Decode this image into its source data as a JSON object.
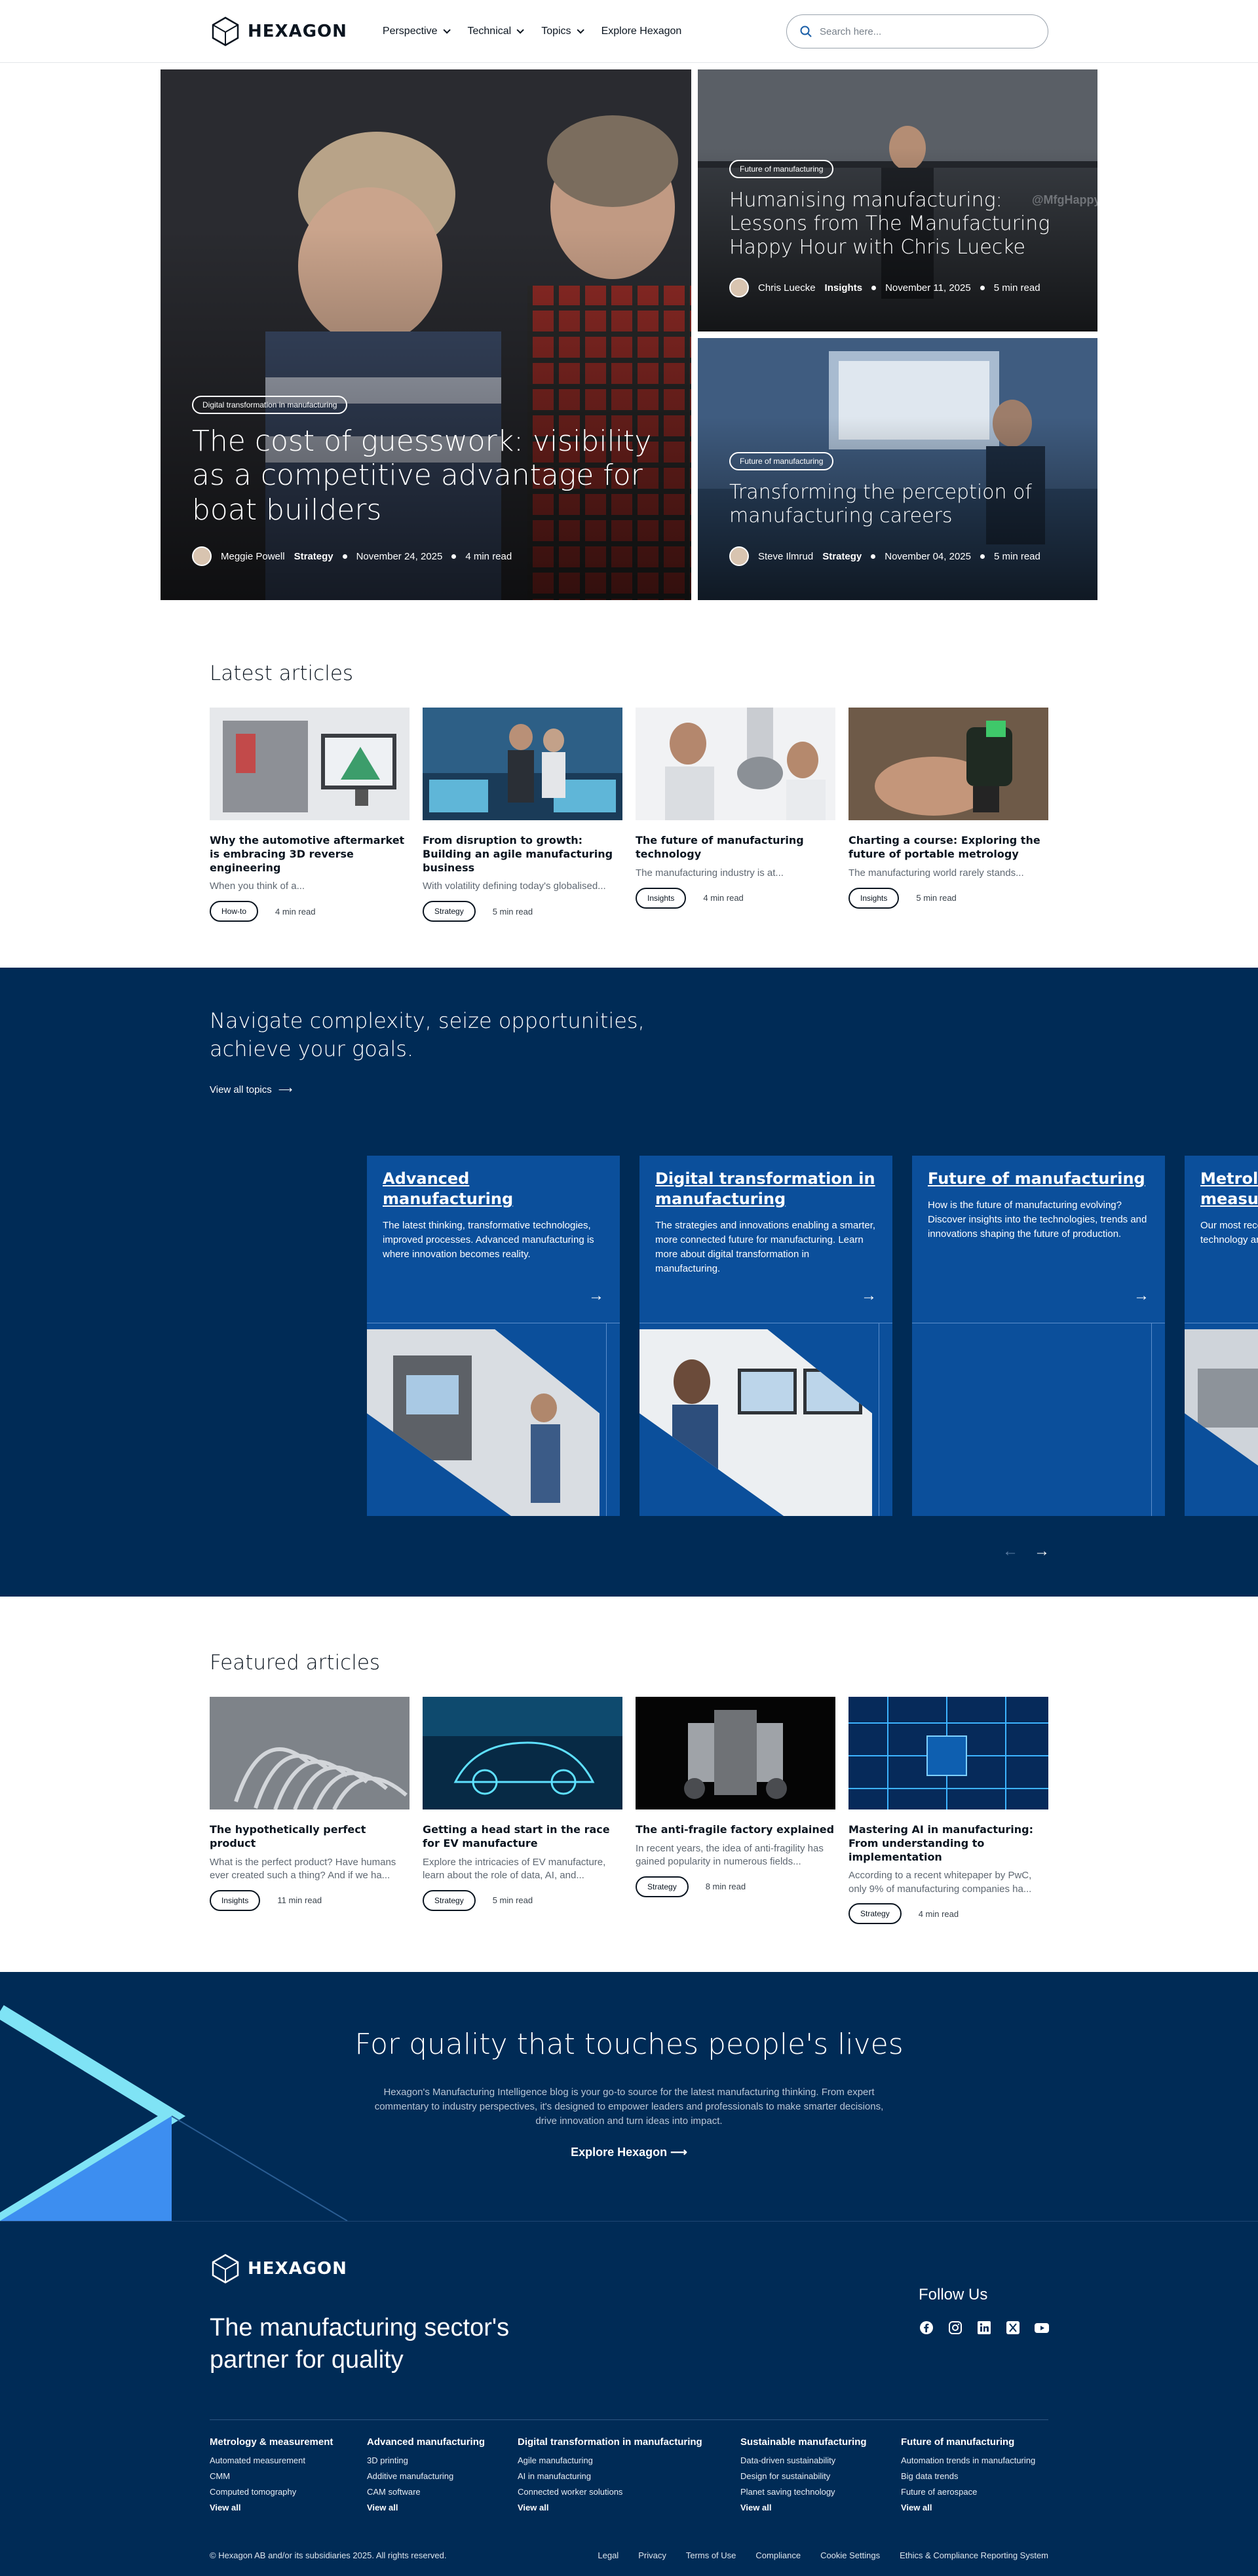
{
  "header": {
    "brand": "HEXAGON",
    "nav": [
      {
        "label": "Perspective",
        "has_menu": true
      },
      {
        "label": "Technical",
        "has_menu": true
      },
      {
        "label": "Topics",
        "has_menu": true
      },
      {
        "label": "Explore Hexagon",
        "has_menu": false
      }
    ],
    "search_placeholder": "Search here..."
  },
  "hero": {
    "main": {
      "tag": "Digital transformation in manufacturing",
      "title": "The cost of guesswork: visibility as a competitive advantage for boat builders",
      "author": "Meggie Powell",
      "category": "Strategy",
      "date": "November 24, 2025",
      "read": "4 min read"
    },
    "side": [
      {
        "tag": "Future of manufacturing",
        "title": "Humanising manufacturing: Lessons from The Manufacturing Happy Hour with Chris Luecke",
        "author": "Chris Luecke",
        "category": "Insights",
        "date": "November 11, 2025",
        "read": "5 min read"
      },
      {
        "tag": "Future of manufacturing",
        "title": "Transforming the perception of manufacturing careers",
        "author": "Steve Ilmrud",
        "category": "Strategy",
        "date": "November 04, 2025",
        "read": "5 min read"
      }
    ]
  },
  "latest": {
    "title": "Latest articles",
    "items": [
      {
        "title": "Why the automotive aftermarket is embracing 3D reverse engineering",
        "excerpt": "When you think of a...",
        "tag": "How-to",
        "read": "4 min read"
      },
      {
        "title": "From disruption to growth: Building an agile manufacturing business",
        "excerpt": "With volatility defining today's globalised...",
        "tag": "Strategy",
        "read": "5 min read"
      },
      {
        "title": "The future of manufacturing technology",
        "excerpt": "The manufacturing industry is at...",
        "tag": "Insights",
        "read": "4 min read"
      },
      {
        "title": "Charting a course: Exploring the future of portable metrology",
        "excerpt": "The manufacturing world rarely stands...",
        "tag": "Insights",
        "read": "5 min read"
      }
    ]
  },
  "topics": {
    "heading": "Navigate complexity, seize opportunities, achieve your goals.",
    "view_all": "View all topics",
    "cards": [
      {
        "title": "Advanced manufacturing",
        "text": "The latest thinking, transformative technologies, improved processes. Advanced manufacturing is where innovation becomes reality."
      },
      {
        "title": "Digital transformation in manufacturing",
        "text": "The strategies and innovations enabling a smarter, more connected future for manufacturing. Learn more about digital transformation in manufacturing."
      },
      {
        "title": "Future of manufacturing",
        "text": "How is the future of manufacturing evolving? Discover insights into the technologies, trends and innovations shaping the future of production."
      },
      {
        "title": "Metrology & measurement",
        "text": "Our most recent thinking on measurement technology and the standards and..."
      }
    ]
  },
  "featured": {
    "title": "Featured articles",
    "items": [
      {
        "title": "The hypothetically perfect product",
        "excerpt": "What is the perfect product? Have humans ever created such a thing? And if we ha...",
        "tag": "Insights",
        "read": "11 min read"
      },
      {
        "title": "Getting a head start in the race for EV manufacture",
        "excerpt": "Explore the intricacies of EV manufacture, learn about the role of data, AI, and...",
        "tag": "Strategy",
        "read": "5 min read"
      },
      {
        "title": "The anti-fragile factory explained",
        "excerpt": "In recent years, the idea of anti-fragility has gained popularity in numerous fields...",
        "tag": "Strategy",
        "read": "8 min read"
      },
      {
        "title": "Mastering AI in manufacturing: From understanding to implementation",
        "excerpt": "According to a recent whitepaper by PwC, only 9% of manufacturing companies ha...",
        "tag": "Strategy",
        "read": "4 min read"
      }
    ]
  },
  "cta": {
    "title": "For quality that touches people's lives",
    "text": "Hexagon's Manufacturing Intelligence blog is your go-to source for the latest manufacturing thinking. From expert commentary to industry perspectives, it's designed to empower leaders and professionals to make smarter decisions, drive innovation and turn ideas into impact.",
    "link": "Explore Hexagon"
  },
  "footer": {
    "brand": "HEXAGON",
    "tagline": "The manufacturing sector's partner for quality",
    "follow": "Follow Us",
    "social": [
      "facebook-icon",
      "instagram-icon",
      "linkedin-icon",
      "x-icon",
      "youtube-icon"
    ],
    "columns": [
      {
        "title": "Metrology & measurement",
        "links": [
          "Automated measurement",
          "CMM",
          "Computed tomography"
        ],
        "all": "View all"
      },
      {
        "title": "Advanced manufacturing",
        "links": [
          "3D printing",
          "Additive manufacturing",
          "CAM software"
        ],
        "all": "View all"
      },
      {
        "title": "Digital transformation in manufacturing",
        "links": [
          "Agile manufacturing",
          "AI in manufacturing",
          "Connected worker solutions"
        ],
        "all": "View all"
      },
      {
        "title": "Sustainable manufacturing",
        "links": [
          "Data-driven sustainability",
          "Design for sustainability",
          "Planet saving technology"
        ],
        "all": "View all"
      },
      {
        "title": "Future of manufacturing",
        "links": [
          "Automation trends in manufacturing",
          "Big data trends",
          "Future of aerospace"
        ],
        "all": "View all"
      }
    ],
    "copyright": "© Hexagon AB and/or its subsidiaries 2025. All rights reserved.",
    "legal": [
      "Legal",
      "Privacy",
      "Terms of Use",
      "Compliance",
      "Cookie Settings",
      "Ethics & Compliance Reporting System"
    ]
  },
  "colors": {
    "navy": "#002b56",
    "topic_blue": "#0b4f9b",
    "accent_light": "#7fe3f5"
  }
}
